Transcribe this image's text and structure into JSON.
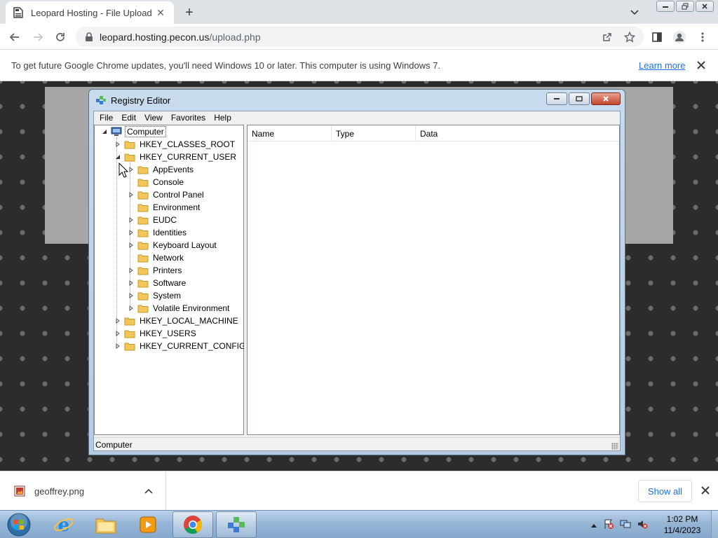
{
  "browser": {
    "tab_title": "Leopard Hosting - File Upload",
    "url_host": "leopard.hosting.pecon.us",
    "url_path": "/upload.php",
    "infobar_text": "To get future Google Chrome updates, you'll need Windows 10 or later. This computer is using Windows 7.",
    "infobar_link": "Learn more"
  },
  "regedit": {
    "title": "Registry Editor",
    "menu": [
      "File",
      "Edit",
      "View",
      "Favorites",
      "Help"
    ],
    "root": "Computer",
    "hives": [
      "HKEY_CLASSES_ROOT",
      "HKEY_CURRENT_USER",
      "HKEY_LOCAL_MACHINE",
      "HKEY_USERS",
      "HKEY_CURRENT_CONFIG"
    ],
    "current_user_children": [
      "AppEvents",
      "Console",
      "Control Panel",
      "Environment",
      "EUDC",
      "Identities",
      "Keyboard Layout",
      "Network",
      "Printers",
      "Software",
      "System",
      "Volatile Environment"
    ],
    "columns": [
      "Name",
      "Type",
      "Data"
    ],
    "status": "Computer"
  },
  "downloads": {
    "file_name": "geoffrey.png",
    "show_all": "Show all"
  },
  "taskbar": {
    "time": "1:02 PM",
    "date": "11/4/2023",
    "apps": [
      "internet-explorer",
      "file-explorer",
      "media-player",
      "chrome",
      "registry-editor"
    ]
  },
  "colors": {
    "chrome_link": "#1a73e8",
    "taskbar": "#97b6d6",
    "regedit_frame": "#b3cbe3"
  }
}
